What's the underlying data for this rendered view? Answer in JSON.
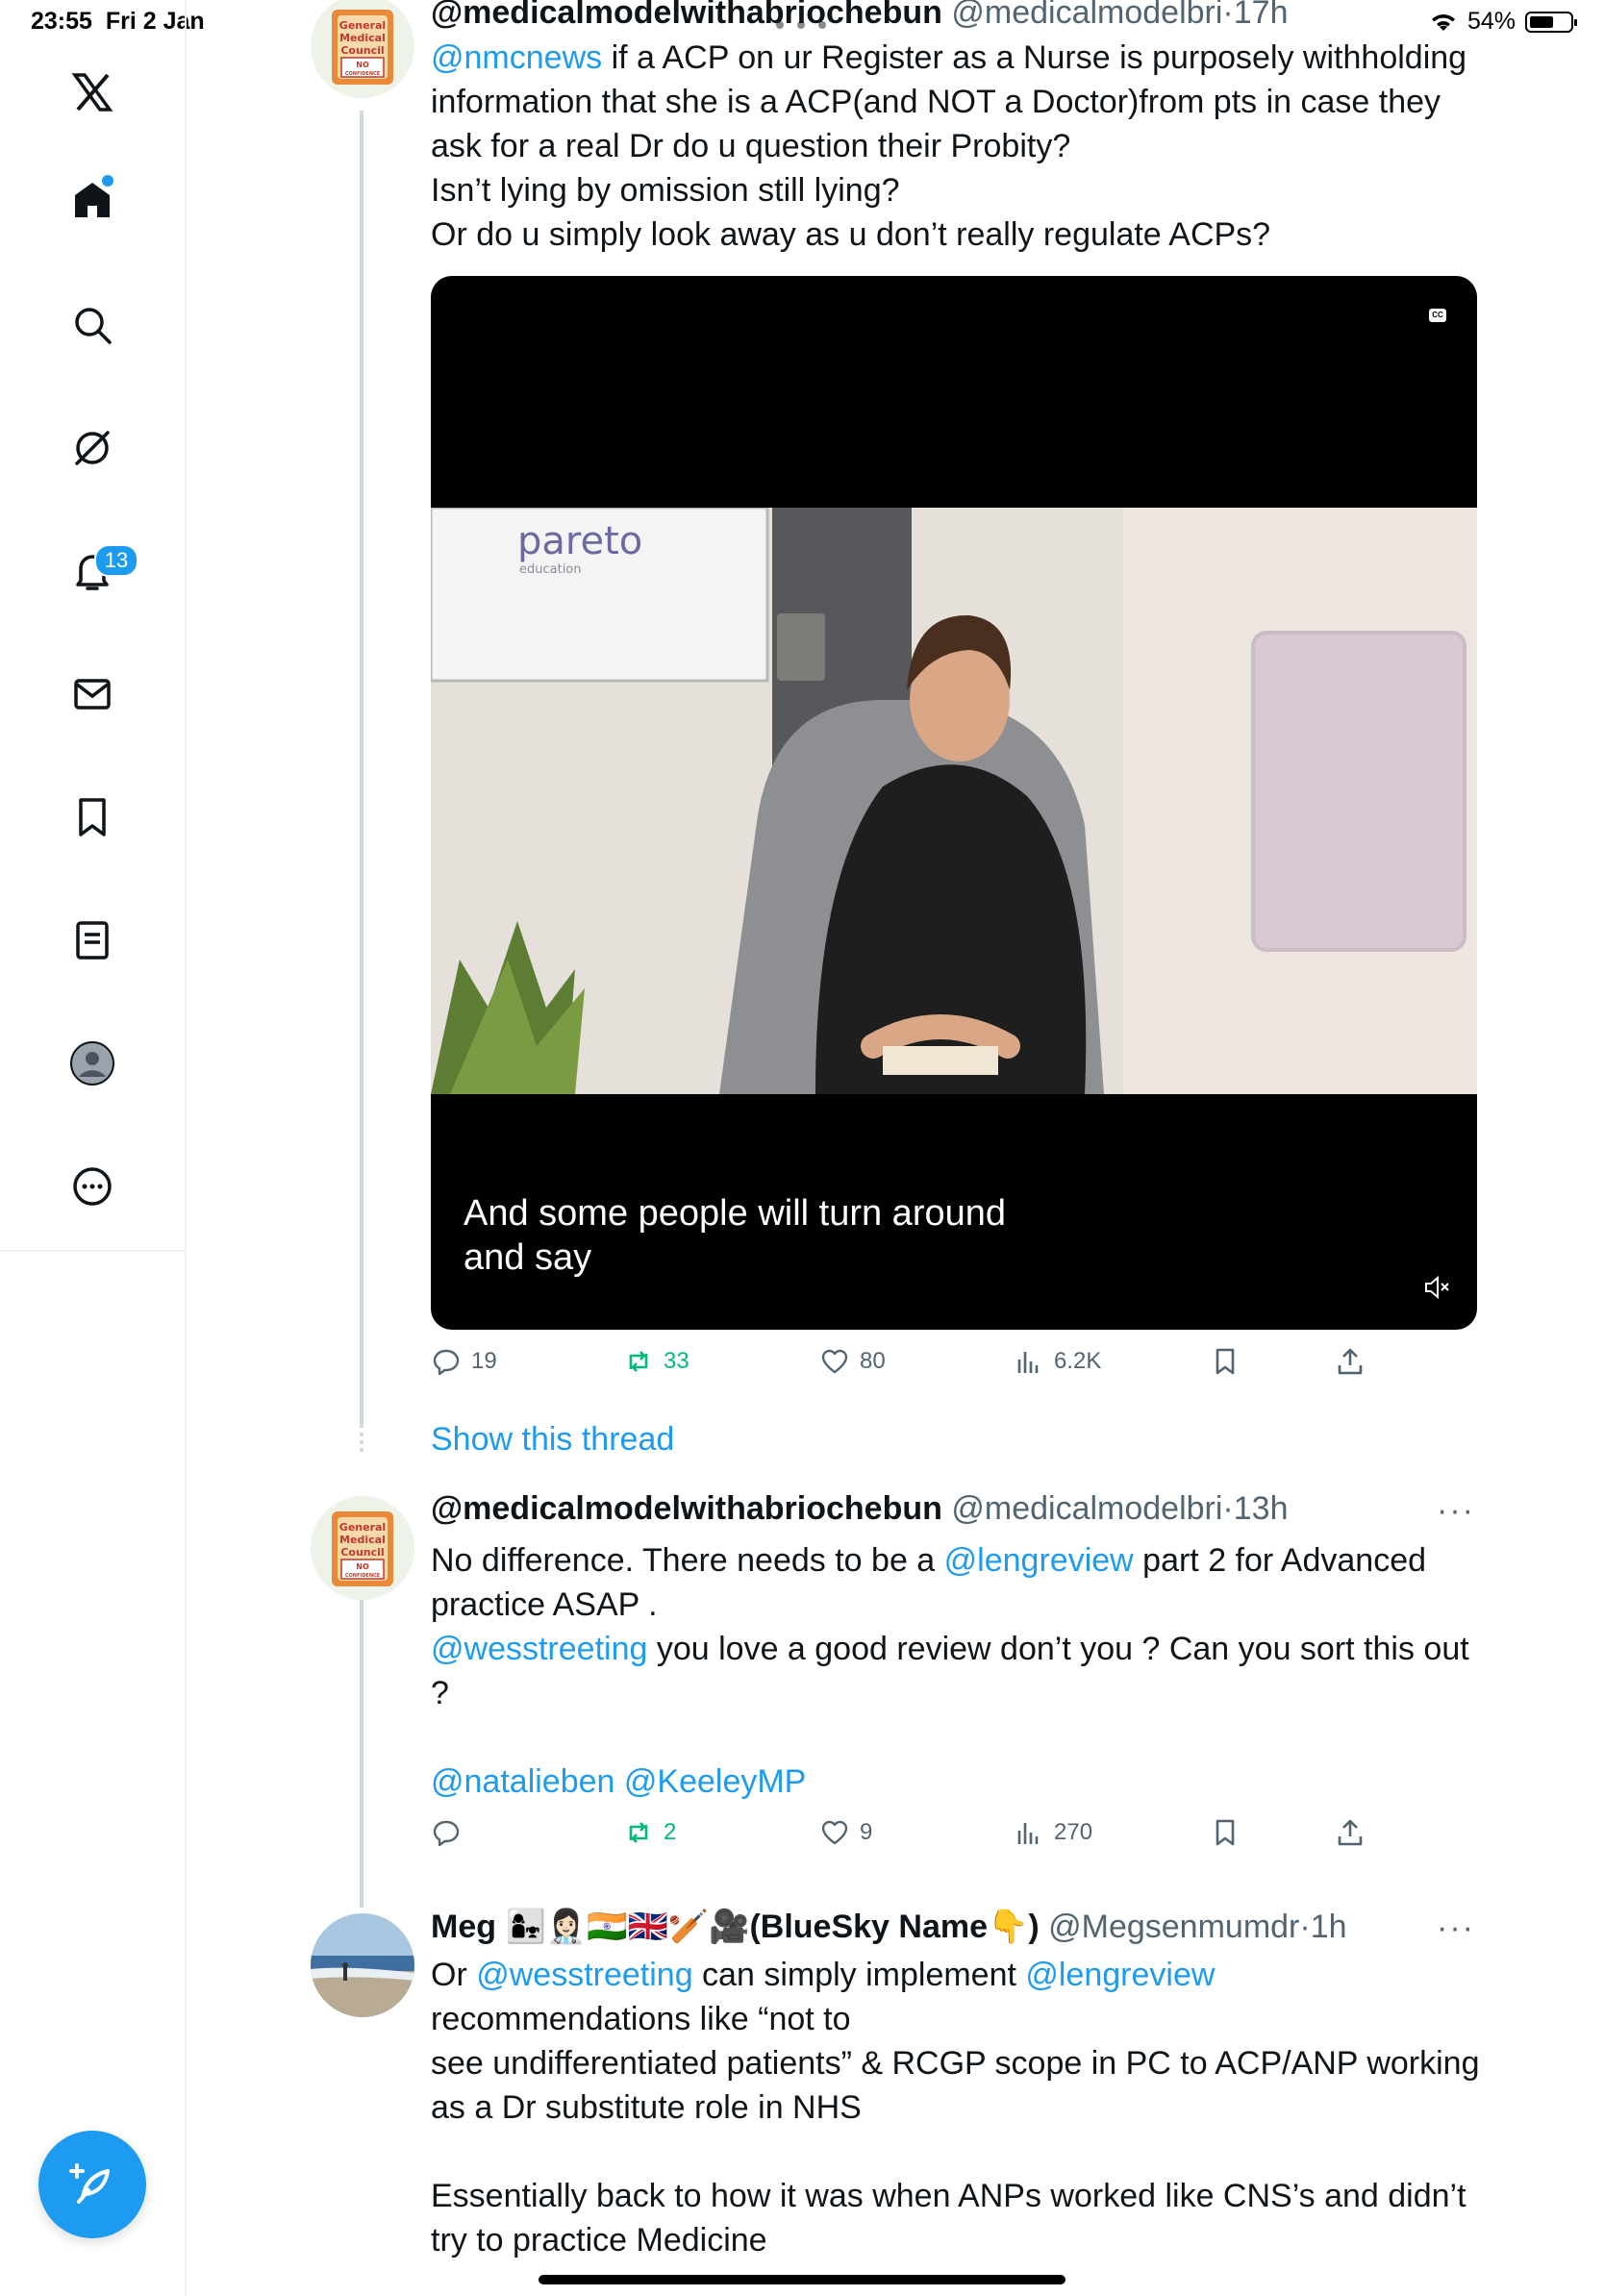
{
  "status_bar": {
    "time": "23:55",
    "date": "Fri 2 Jan",
    "battery": "54%"
  },
  "sidebar": {
    "notifications_count": "13",
    "items": [
      "x-logo",
      "home",
      "search",
      "grok",
      "notifications",
      "messages",
      "bookmarks",
      "lists",
      "profile",
      "more"
    ]
  },
  "tweets": [
    {
      "display_name": "@medicalmodelwithabriochebun",
      "handle": "@medicalmodelbri",
      "sep": "·",
      "time": "17h",
      "mention": "@nmcnews",
      "text_1": " if a ACP on ur Register as a Nurse is purposely withholding information that she is a ACP(and NOT a Doctor)from pts in case they ask for a real Dr do u question their Probity?",
      "text_2": "Isn’t lying by omission still lying?",
      "text_3": "Or do u simply look away as u don’t really regulate ACPs?",
      "video_logo": "pareto",
      "video_logo_sub": "education",
      "video_cc": "CC",
      "video_caption_1": "And some people will turn around",
      "video_caption_2": "and say",
      "replies": "19",
      "reposts": "33",
      "likes": "80",
      "views": "6.2K"
    },
    {
      "display_name": "@medicalmodelwithabriochebun",
      "handle": "@medicalmodelbri",
      "sep": "·",
      "time": "13h",
      "more": "···",
      "t1": "No difference. There needs to be a ",
      "m1": "@lengreview",
      "t2": " part 2 for Advanced practice ASAP .",
      "m2": "@wesstreeting",
      "t3": " you love a good review don’t you ? Can you sort this out ?",
      "m3": "@natalieben",
      "m4": "@KeeleyMP",
      "replies": "",
      "reposts": "2",
      "likes": "9",
      "views": "270"
    },
    {
      "display_name": "Meg 👩‍👧👩🏻‍⚕️🇮🇳🇬🇧🏏🎥(BlueSky Name👇)",
      "handle": "@Megsenmumdr",
      "sep": "·",
      "time": "1h",
      "more": "···",
      "t1": "Or ",
      "m1": "@wesstreeting",
      "t2": " can simply implement ",
      "m2": "@lengreview",
      "t3": "recommendations like “not to",
      "t4": "see undifferentiated patients” & RCGP scope in PC to ACP/ANP working as a Dr substitute role in NHS",
      "t5": "Essentially back to how it was when ANPs worked like CNS’s and didn’t try to practice Medicine"
    }
  ],
  "show_thread": "Show this thread",
  "avatar_gmc_text": [
    "General",
    "Medical",
    "Council",
    "NO",
    "CONFIDENCE"
  ],
  "colors": {
    "accent": "#1d9bf0",
    "repost": "#00ba7c",
    "muted": "#536471"
  }
}
